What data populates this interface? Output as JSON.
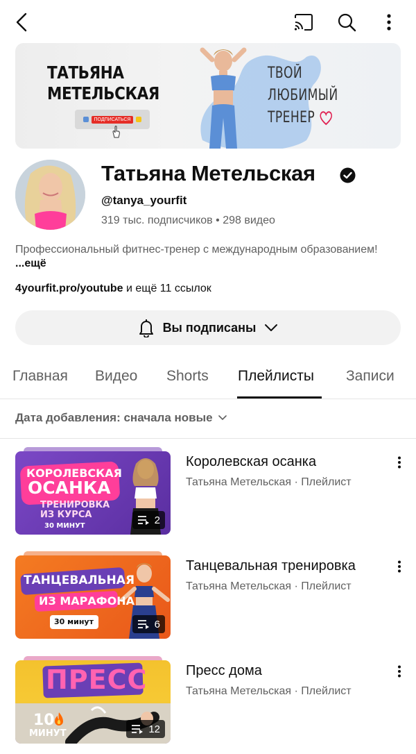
{
  "topbar": {
    "icons": [
      "back-arrow-icon",
      "cast-icon",
      "search-icon",
      "more-vert-icon"
    ]
  },
  "banner": {
    "name_line1": "ТАТЬЯНА",
    "name_line2": "МЕТЕЛЬСКАЯ",
    "subscribe_label": "ПОДПИСАТЬСЯ",
    "tagline_line1": "ТВОЙ",
    "tagline_line2": "ЛЮБИМЫЙ",
    "tagline_line3": "ТРЕНЕР"
  },
  "channel": {
    "name": "Татьяна Метельская",
    "handle": "@tanya_yourfit",
    "subscribers": "319 тыс. подписчиков",
    "stats_sep": " • ",
    "videos": "298 видео",
    "description": "Профессиональный фитнес-тренер с международным образованием! ",
    "description_more": "...ещё",
    "link": "4yourfit.pro/youtube",
    "links_more": " и ещё 11 ссылок",
    "subscribed_label": "Вы подписаны"
  },
  "tabs": [
    {
      "label": "Главная"
    },
    {
      "label": "Видео"
    },
    {
      "label": "Shorts"
    },
    {
      "label": "Плейлисты",
      "active": true
    },
    {
      "label": "Записи"
    }
  ],
  "sort": {
    "label": "Дата добавления: сначала новые"
  },
  "playlists": [
    {
      "title": "Королевская осанка",
      "meta": "Татьяна Метельская · Плейлист",
      "count": "2",
      "thumb_line1": "КОРОЛЕВСКАЯ",
      "thumb_line2": "ОСАНКА",
      "thumb_line3": "ТРЕНИРОВКА",
      "thumb_line4": "ИЗ КУРСА",
      "thumb_line5": "30 МИНУТ"
    },
    {
      "title": "Танцевальная тренировка",
      "meta": "Татьяна Метельская · Плейлист",
      "count": "6",
      "thumb_line1": "ТАНЦЕВАЛЬНАЯ",
      "thumb_line2": "ИЗ МАРАФОНА",
      "thumb_line3": "30 минут"
    },
    {
      "title": "Пресс дома",
      "meta": "Татьяна Метельская · Плейлист",
      "count": "12",
      "thumb_line1": "ПРЕСС",
      "thumb_line2": "10",
      "thumb_line3": "МИНУТ"
    }
  ],
  "colors": {
    "accent_purple": "#6a3fb5",
    "accent_orange": "#f26a1b",
    "accent_yellow": "#f5c518",
    "pink": "#ff3e9a",
    "splash_blue": "#9ec3ea",
    "text_secondary": "#606060"
  }
}
